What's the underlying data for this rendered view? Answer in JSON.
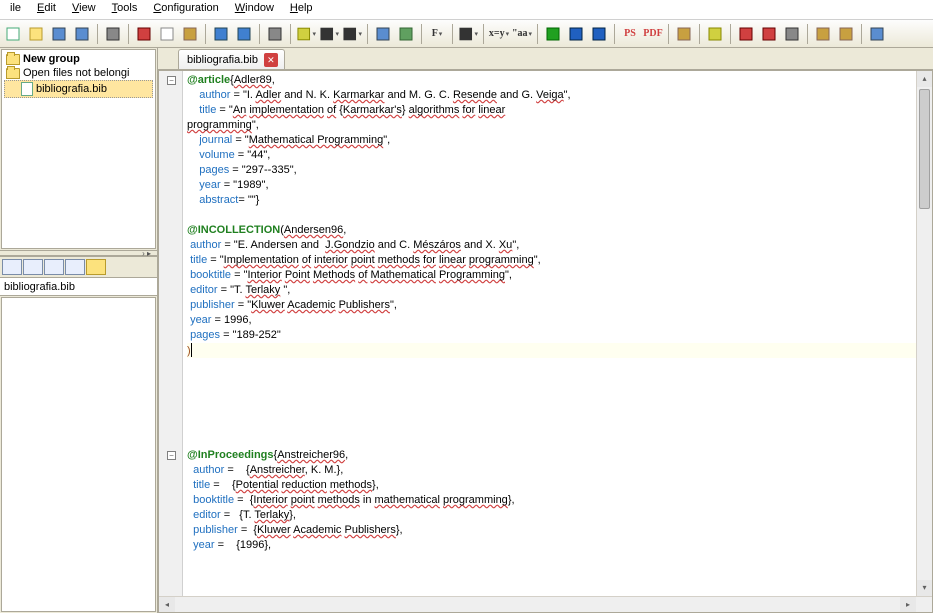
{
  "menus": [
    "ile",
    "Edit",
    "View",
    "Tools",
    "Configuration",
    "Window",
    "Help"
  ],
  "menu_underline_idx": [
    -1,
    0,
    0,
    0,
    0,
    0,
    0
  ],
  "left_panel": {
    "nodes": [
      {
        "label": "New group",
        "icon": "folder",
        "new": true
      },
      {
        "label": "Open files not belongi",
        "icon": "folder"
      },
      {
        "label": "bibliografia.bib",
        "icon": "file",
        "indent": 1,
        "selected": true
      }
    ],
    "path": "bibliografia.bib"
  },
  "tabs": [
    {
      "label": "bibliografia.bib",
      "closable": true
    }
  ],
  "fold_positions": [
    0,
    25
  ],
  "code": [
    {
      "t": [
        {
          "c": "kw",
          "s": "@article"
        },
        {
          "c": "",
          "s": "{"
        },
        {
          "c": "sq",
          "s": "Adler89"
        },
        {
          "c": "",
          "s": ","
        }
      ]
    },
    {
      "t": [
        {
          "c": "",
          "s": "    "
        },
        {
          "c": "fld",
          "s": "author"
        },
        {
          "c": "",
          "s": " = \"I. "
        },
        {
          "c": "sq",
          "s": "Adler"
        },
        {
          "c": "",
          "s": " and N. K. "
        },
        {
          "c": "sq",
          "s": "Karmarkar"
        },
        {
          "c": "",
          "s": " and M. G. C. "
        },
        {
          "c": "sq",
          "s": "Resende"
        },
        {
          "c": "",
          "s": " and G. "
        },
        {
          "c": "sq",
          "s": "Veiga"
        },
        {
          "c": "",
          "s": "\","
        }
      ]
    },
    {
      "t": [
        {
          "c": "",
          "s": "    "
        },
        {
          "c": "fld",
          "s": "title"
        },
        {
          "c": "",
          "s": " = \""
        },
        {
          "c": "sq",
          "s": "An"
        },
        {
          "c": "",
          "s": " "
        },
        {
          "c": "sq",
          "s": "implementation"
        },
        {
          "c": "",
          "s": " "
        },
        {
          "c": "sq",
          "s": "of"
        },
        {
          "c": "",
          "s": " {"
        },
        {
          "c": "sq",
          "s": "Karmarkar's"
        },
        {
          "c": "",
          "s": "} "
        },
        {
          "c": "sq",
          "s": "algorithms"
        },
        {
          "c": "",
          "s": " "
        },
        {
          "c": "sq",
          "s": "for"
        },
        {
          "c": "",
          "s": " "
        },
        {
          "c": "sq",
          "s": "linear"
        }
      ]
    },
    {
      "t": [
        {
          "c": "sq",
          "s": "programming"
        },
        {
          "c": "",
          "s": "\","
        }
      ]
    },
    {
      "t": [
        {
          "c": "",
          "s": "    "
        },
        {
          "c": "fld",
          "s": "journal"
        },
        {
          "c": "",
          "s": " = \""
        },
        {
          "c": "sq",
          "s": "Mathematical Programming"
        },
        {
          "c": "",
          "s": "\","
        }
      ]
    },
    {
      "t": [
        {
          "c": "",
          "s": "    "
        },
        {
          "c": "fld",
          "s": "volume"
        },
        {
          "c": "",
          "s": " = \"44\","
        }
      ]
    },
    {
      "t": [
        {
          "c": "",
          "s": "    "
        },
        {
          "c": "fld",
          "s": "pages"
        },
        {
          "c": "",
          "s": " = \"297--335\","
        }
      ]
    },
    {
      "t": [
        {
          "c": "",
          "s": "    "
        },
        {
          "c": "fld",
          "s": "year"
        },
        {
          "c": "",
          "s": " = \"1989\","
        }
      ]
    },
    {
      "t": [
        {
          "c": "",
          "s": "    "
        },
        {
          "c": "fld",
          "s": "abstract"
        },
        {
          "c": "",
          "s": "= \"\"}"
        }
      ]
    },
    {
      "t": []
    },
    {
      "t": [
        {
          "c": "kw",
          "s": "@INCOLLECTION"
        },
        {
          "c": "",
          "s": "("
        },
        {
          "c": "sq",
          "s": "Andersen96"
        },
        {
          "c": "",
          "s": ","
        }
      ]
    },
    {
      "t": [
        {
          "c": "",
          "s": " "
        },
        {
          "c": "fld",
          "s": "author"
        },
        {
          "c": "",
          "s": " = \"E. Andersen and  "
        },
        {
          "c": "sq",
          "s": "J.Gondzio"
        },
        {
          "c": "",
          "s": " and C. "
        },
        {
          "c": "sq",
          "s": "Mészáros"
        },
        {
          "c": "",
          "s": " and X. "
        },
        {
          "c": "sq",
          "s": "Xu"
        },
        {
          "c": "",
          "s": "\","
        }
      ]
    },
    {
      "t": [
        {
          "c": "",
          "s": " "
        },
        {
          "c": "fld",
          "s": "title"
        },
        {
          "c": "",
          "s": " = \""
        },
        {
          "c": "sq",
          "s": "Implementation"
        },
        {
          "c": "",
          "s": " "
        },
        {
          "c": "sq",
          "s": "of"
        },
        {
          "c": "",
          "s": " "
        },
        {
          "c": "sq",
          "s": "interior"
        },
        {
          "c": "",
          "s": " "
        },
        {
          "c": "sq",
          "s": "point"
        },
        {
          "c": "",
          "s": " "
        },
        {
          "c": "sq",
          "s": "methods"
        },
        {
          "c": "",
          "s": " "
        },
        {
          "c": "sq",
          "s": "for"
        },
        {
          "c": "",
          "s": " "
        },
        {
          "c": "sq",
          "s": "linear"
        },
        {
          "c": "",
          "s": " "
        },
        {
          "c": "sq",
          "s": "programming"
        },
        {
          "c": "",
          "s": "\","
        }
      ]
    },
    {
      "t": [
        {
          "c": "",
          "s": " "
        },
        {
          "c": "fld",
          "s": "booktitle"
        },
        {
          "c": "",
          "s": " = \""
        },
        {
          "c": "sq",
          "s": "Interior"
        },
        {
          "c": "",
          "s": " "
        },
        {
          "c": "sq",
          "s": "Point"
        },
        {
          "c": "",
          "s": " "
        },
        {
          "c": "sq",
          "s": "Methods"
        },
        {
          "c": "",
          "s": " "
        },
        {
          "c": "sq",
          "s": "of"
        },
        {
          "c": "",
          "s": " "
        },
        {
          "c": "sq",
          "s": "Mathematical"
        },
        {
          "c": "",
          "s": " "
        },
        {
          "c": "sq",
          "s": "Programming"
        },
        {
          "c": "",
          "s": "\","
        }
      ]
    },
    {
      "t": [
        {
          "c": "",
          "s": " "
        },
        {
          "c": "fld",
          "s": "editor"
        },
        {
          "c": "",
          "s": " = \"T. "
        },
        {
          "c": "sq",
          "s": "Terlaky"
        },
        {
          "c": "",
          "s": " \","
        }
      ]
    },
    {
      "t": [
        {
          "c": "",
          "s": " "
        },
        {
          "c": "fld",
          "s": "publisher"
        },
        {
          "c": "",
          "s": " = \""
        },
        {
          "c": "sq",
          "s": "Kluwer"
        },
        {
          "c": "",
          "s": " "
        },
        {
          "c": "sq",
          "s": "Academic"
        },
        {
          "c": "",
          "s": " "
        },
        {
          "c": "sq",
          "s": "Publishers"
        },
        {
          "c": "",
          "s": "\","
        }
      ]
    },
    {
      "t": [
        {
          "c": "",
          "s": " "
        },
        {
          "c": "fld",
          "s": "year"
        },
        {
          "c": "",
          "s": " = 1996,"
        }
      ]
    },
    {
      "t": [
        {
          "c": "",
          "s": " "
        },
        {
          "c": "fld",
          "s": "pages"
        },
        {
          "c": "",
          "s": " = \"189-252\""
        }
      ]
    },
    {
      "t": [
        {
          "c": "str",
          "s": ")"
        }
      ],
      "hl": true,
      "caret": true
    },
    {
      "t": []
    },
    {
      "t": []
    },
    {
      "t": []
    },
    {
      "t": []
    },
    {
      "t": []
    },
    {
      "t": []
    },
    {
      "t": [
        {
          "c": "kw",
          "s": "@InProceedings"
        },
        {
          "c": "",
          "s": "{"
        },
        {
          "c": "sq",
          "s": "Anstreicher96"
        },
        {
          "c": "",
          "s": ","
        }
      ]
    },
    {
      "t": [
        {
          "c": "",
          "s": "  "
        },
        {
          "c": "fld",
          "s": "author"
        },
        {
          "c": "",
          "s": " =    {"
        },
        {
          "c": "sq",
          "s": "Anstreicher"
        },
        {
          "c": "",
          "s": ", K. M.},"
        }
      ]
    },
    {
      "t": [
        {
          "c": "",
          "s": "  "
        },
        {
          "c": "fld",
          "s": "title"
        },
        {
          "c": "",
          "s": " =    {"
        },
        {
          "c": "sq",
          "s": "Potential"
        },
        {
          "c": "",
          "s": " "
        },
        {
          "c": "sq",
          "s": "reduction"
        },
        {
          "c": "",
          "s": " "
        },
        {
          "c": "sq",
          "s": "methods"
        },
        {
          "c": "",
          "s": "},"
        }
      ]
    },
    {
      "t": [
        {
          "c": "",
          "s": "  "
        },
        {
          "c": "fld",
          "s": "booktitle"
        },
        {
          "c": "",
          "s": " =  {"
        },
        {
          "c": "sq",
          "s": "Interior"
        },
        {
          "c": "",
          "s": " "
        },
        {
          "c": "sq",
          "s": "point"
        },
        {
          "c": "",
          "s": " "
        },
        {
          "c": "sq",
          "s": "methods"
        },
        {
          "c": "",
          "s": " in "
        },
        {
          "c": "sq",
          "s": "mathematical"
        },
        {
          "c": "",
          "s": " "
        },
        {
          "c": "sq",
          "s": "programming"
        },
        {
          "c": "",
          "s": "},"
        }
      ]
    },
    {
      "t": [
        {
          "c": "",
          "s": "  "
        },
        {
          "c": "fld",
          "s": "editor"
        },
        {
          "c": "",
          "s": " =   {T. "
        },
        {
          "c": "sq",
          "s": "Terlaky"
        },
        {
          "c": "",
          "s": "},"
        }
      ]
    },
    {
      "t": [
        {
          "c": "",
          "s": "  "
        },
        {
          "c": "fld",
          "s": "publisher"
        },
        {
          "c": "",
          "s": " =  {"
        },
        {
          "c": "sq",
          "s": "Kluwer"
        },
        {
          "c": "",
          "s": " "
        },
        {
          "c": "sq",
          "s": "Academic"
        },
        {
          "c": "",
          "s": " "
        },
        {
          "c": "sq",
          "s": "Publishers"
        },
        {
          "c": "",
          "s": "},"
        }
      ]
    },
    {
      "t": [
        {
          "c": "",
          "s": "  "
        },
        {
          "c": "fld",
          "s": "year"
        },
        {
          "c": "",
          "s": " =    {1996},"
        }
      ]
    }
  ],
  "toolbar_icons": [
    "new-project",
    "open",
    "save",
    "save-all",
    "|",
    "print",
    "|",
    "cut",
    "copy",
    "paste",
    "|",
    "undo",
    "redo",
    "|",
    "find",
    "|",
    "highlight",
    "bullets",
    "numbering",
    "|",
    "table",
    "image",
    "|",
    "font",
    "|",
    "align",
    "|",
    "equation",
    "greek",
    "|",
    "run",
    "play",
    "forward",
    "|",
    "ps",
    "pdf",
    "|",
    "next",
    "|",
    "highlight2",
    "|",
    "ghost",
    "acrobat",
    "zoom",
    "|",
    "grid1",
    "grid2",
    "|",
    "grid3"
  ]
}
